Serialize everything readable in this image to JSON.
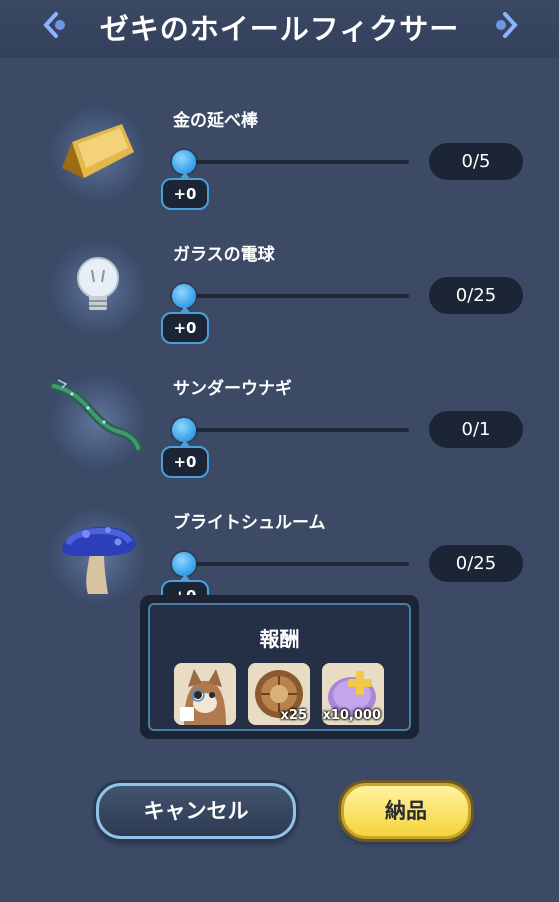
{
  "header": {
    "title": "ゼキのホイールフィクサー"
  },
  "items": [
    {
      "name": "金の延べ棒",
      "icon": "gold-bar-icon",
      "increment": "+0",
      "count": "0/5",
      "progress": 0
    },
    {
      "name": "ガラスの電球",
      "icon": "light-bulb-icon",
      "increment": "+0",
      "count": "0/25",
      "progress": 0
    },
    {
      "name": "サンダーウナギ",
      "icon": "thunder-eel-icon",
      "increment": "+0",
      "count": "0/1",
      "progress": 0
    },
    {
      "name": "ブライトシュルーム",
      "icon": "mushroom-icon",
      "increment": "+0",
      "count": "0/25",
      "progress": 0
    }
  ],
  "reward": {
    "title": "報酬",
    "items": [
      {
        "icon": "cat-character-portrait-icon",
        "qty": ""
      },
      {
        "icon": "bronze-medallion-icon",
        "qty": "x25"
      },
      {
        "icon": "purple-coin-icon",
        "qty": "x10,000"
      }
    ]
  },
  "buttons": {
    "cancel": "キャンセル",
    "submit": "納品"
  },
  "colors": {
    "background": "#3c4a66",
    "slider_knob": "#3fa6ea",
    "pill_bg": "#1c2536",
    "submit_button": "#f5d43c"
  }
}
